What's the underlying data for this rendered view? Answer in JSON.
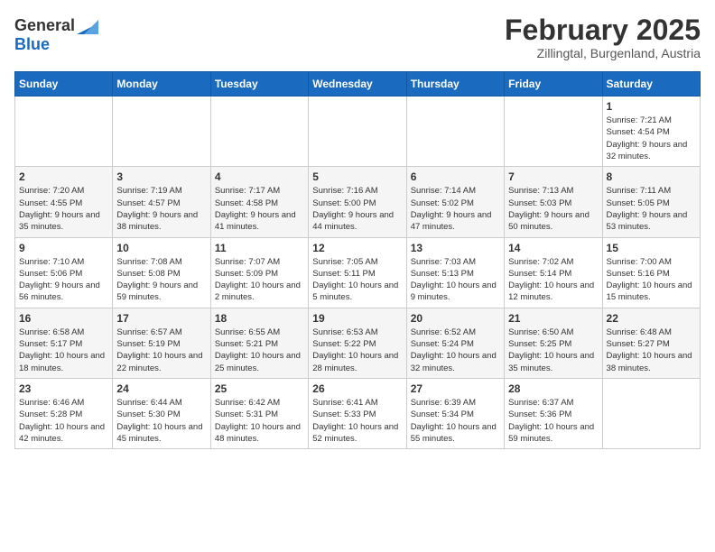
{
  "logo": {
    "general": "General",
    "blue": "Blue"
  },
  "title": {
    "month_year": "February 2025",
    "location": "Zillingtal, Burgenland, Austria"
  },
  "headers": [
    "Sunday",
    "Monday",
    "Tuesday",
    "Wednesday",
    "Thursday",
    "Friday",
    "Saturday"
  ],
  "weeks": [
    [
      {
        "day": "",
        "info": ""
      },
      {
        "day": "",
        "info": ""
      },
      {
        "day": "",
        "info": ""
      },
      {
        "day": "",
        "info": ""
      },
      {
        "day": "",
        "info": ""
      },
      {
        "day": "",
        "info": ""
      },
      {
        "day": "1",
        "info": "Sunrise: 7:21 AM\nSunset: 4:54 PM\nDaylight: 9 hours and 32 minutes."
      }
    ],
    [
      {
        "day": "2",
        "info": "Sunrise: 7:20 AM\nSunset: 4:55 PM\nDaylight: 9 hours and 35 minutes."
      },
      {
        "day": "3",
        "info": "Sunrise: 7:19 AM\nSunset: 4:57 PM\nDaylight: 9 hours and 38 minutes."
      },
      {
        "day": "4",
        "info": "Sunrise: 7:17 AM\nSunset: 4:58 PM\nDaylight: 9 hours and 41 minutes."
      },
      {
        "day": "5",
        "info": "Sunrise: 7:16 AM\nSunset: 5:00 PM\nDaylight: 9 hours and 44 minutes."
      },
      {
        "day": "6",
        "info": "Sunrise: 7:14 AM\nSunset: 5:02 PM\nDaylight: 9 hours and 47 minutes."
      },
      {
        "day": "7",
        "info": "Sunrise: 7:13 AM\nSunset: 5:03 PM\nDaylight: 9 hours and 50 minutes."
      },
      {
        "day": "8",
        "info": "Sunrise: 7:11 AM\nSunset: 5:05 PM\nDaylight: 9 hours and 53 minutes."
      }
    ],
    [
      {
        "day": "9",
        "info": "Sunrise: 7:10 AM\nSunset: 5:06 PM\nDaylight: 9 hours and 56 minutes."
      },
      {
        "day": "10",
        "info": "Sunrise: 7:08 AM\nSunset: 5:08 PM\nDaylight: 9 hours and 59 minutes."
      },
      {
        "day": "11",
        "info": "Sunrise: 7:07 AM\nSunset: 5:09 PM\nDaylight: 10 hours and 2 minutes."
      },
      {
        "day": "12",
        "info": "Sunrise: 7:05 AM\nSunset: 5:11 PM\nDaylight: 10 hours and 5 minutes."
      },
      {
        "day": "13",
        "info": "Sunrise: 7:03 AM\nSunset: 5:13 PM\nDaylight: 10 hours and 9 minutes."
      },
      {
        "day": "14",
        "info": "Sunrise: 7:02 AM\nSunset: 5:14 PM\nDaylight: 10 hours and 12 minutes."
      },
      {
        "day": "15",
        "info": "Sunrise: 7:00 AM\nSunset: 5:16 PM\nDaylight: 10 hours and 15 minutes."
      }
    ],
    [
      {
        "day": "16",
        "info": "Sunrise: 6:58 AM\nSunset: 5:17 PM\nDaylight: 10 hours and 18 minutes."
      },
      {
        "day": "17",
        "info": "Sunrise: 6:57 AM\nSunset: 5:19 PM\nDaylight: 10 hours and 22 minutes."
      },
      {
        "day": "18",
        "info": "Sunrise: 6:55 AM\nSunset: 5:21 PM\nDaylight: 10 hours and 25 minutes."
      },
      {
        "day": "19",
        "info": "Sunrise: 6:53 AM\nSunset: 5:22 PM\nDaylight: 10 hours and 28 minutes."
      },
      {
        "day": "20",
        "info": "Sunrise: 6:52 AM\nSunset: 5:24 PM\nDaylight: 10 hours and 32 minutes."
      },
      {
        "day": "21",
        "info": "Sunrise: 6:50 AM\nSunset: 5:25 PM\nDaylight: 10 hours and 35 minutes."
      },
      {
        "day": "22",
        "info": "Sunrise: 6:48 AM\nSunset: 5:27 PM\nDaylight: 10 hours and 38 minutes."
      }
    ],
    [
      {
        "day": "23",
        "info": "Sunrise: 6:46 AM\nSunset: 5:28 PM\nDaylight: 10 hours and 42 minutes."
      },
      {
        "day": "24",
        "info": "Sunrise: 6:44 AM\nSunset: 5:30 PM\nDaylight: 10 hours and 45 minutes."
      },
      {
        "day": "25",
        "info": "Sunrise: 6:42 AM\nSunset: 5:31 PM\nDaylight: 10 hours and 48 minutes."
      },
      {
        "day": "26",
        "info": "Sunrise: 6:41 AM\nSunset: 5:33 PM\nDaylight: 10 hours and 52 minutes."
      },
      {
        "day": "27",
        "info": "Sunrise: 6:39 AM\nSunset: 5:34 PM\nDaylight: 10 hours and 55 minutes."
      },
      {
        "day": "28",
        "info": "Sunrise: 6:37 AM\nSunset: 5:36 PM\nDaylight: 10 hours and 59 minutes."
      },
      {
        "day": "",
        "info": ""
      }
    ]
  ]
}
